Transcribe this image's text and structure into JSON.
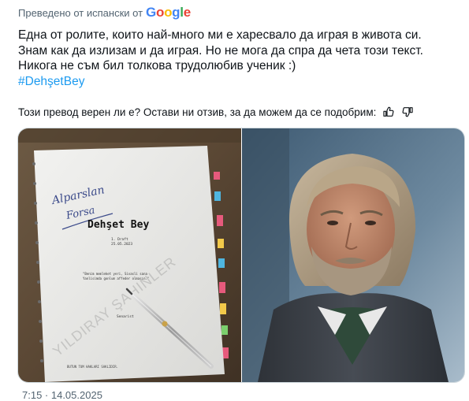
{
  "translation": {
    "label": "Преведено от испански от",
    "google_letters": [
      "G",
      "o",
      "o",
      "g",
      "l",
      "e"
    ]
  },
  "post": {
    "lines": [
      "Една от ролите, които най-много ми е харесвало да играя в живота си.",
      "Знам как да излизам и да играя. Но не мога да спра да чета този текст.",
      "Никога не съм бил толкова трудолюбив ученик :)"
    ],
    "hashtag": "#DehşetBey"
  },
  "feedback": {
    "question": "Този превод верен ли е? Остави ни отзив, за да можем да се подобрим:",
    "thumbs_up_icon": "thumbs-up-icon",
    "thumbs_down_icon": "thumbs-down-icon"
  },
  "media": {
    "script": {
      "title": "Dehşet Bey",
      "handwriting_line1": "Alparslan",
      "handwriting_line2": "Forsa",
      "watermark": "YILDIRAY ŞAHINLER",
      "draft_label": "1. Draft",
      "date": "25.05.2023",
      "quote_line1": "\"Benim memleket yeri, Sivasli sana",
      "quote_line2": "Yanlisimda gonlum affeder olmasın.\"",
      "author": "Senarist",
      "bottom_text": "BUTUN TUM HAKLARI SAKLIDIR."
    },
    "portrait_alt": "actor-portrait"
  },
  "meta": {
    "partial": "7:15 · 14.05.2025"
  }
}
